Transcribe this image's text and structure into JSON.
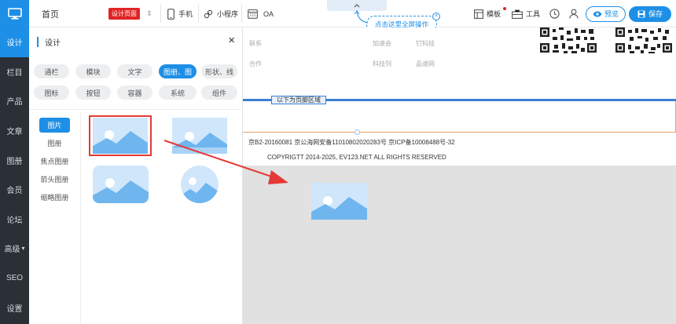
{
  "rail": {
    "items": [
      "设计",
      "栏目",
      "产品",
      "文章",
      "图册",
      "会员",
      "论坛",
      "高级",
      "SEO",
      "设置"
    ],
    "advanced_caret": "▾"
  },
  "topbar": {
    "home": "首页",
    "design_badge": "设计页面",
    "sort_icon": "⇕",
    "mobile": "手机",
    "mini_program": "小程序",
    "oa": "OA",
    "template": "模板",
    "tools": "工具",
    "preview": "预览",
    "save": "保存",
    "fullscreen_tip": "点击这里全屏操作"
  },
  "panel": {
    "title": "设计",
    "close": "×",
    "chips_row1": [
      "通栏",
      "模块",
      "文字",
      "图册、图",
      "形状、线"
    ],
    "chips_row2": [
      "图标",
      "按钮",
      "容器",
      "系统",
      "组件"
    ],
    "subnav": [
      "图片",
      "图册",
      "焦点图册",
      "箭头图册",
      "缩略图册"
    ]
  },
  "canvas": {
    "links": [
      "联系",
      "加速会",
      "钉科技",
      "合作",
      "科技列",
      "品速网"
    ],
    "footer_label": "以下为页脚区域",
    "icp": "京B2-20160081 京公海网安备11010802020283号 京ICP备10008488号-32",
    "copyright": "COPYRIGTT  2014-2025, EV123.NET ALL RIGHTS RESERVED"
  },
  "colors": {
    "accent": "#1e8fe6",
    "rail": "#2b2f36",
    "badge": "#e02424",
    "arrow": "#e53935"
  }
}
